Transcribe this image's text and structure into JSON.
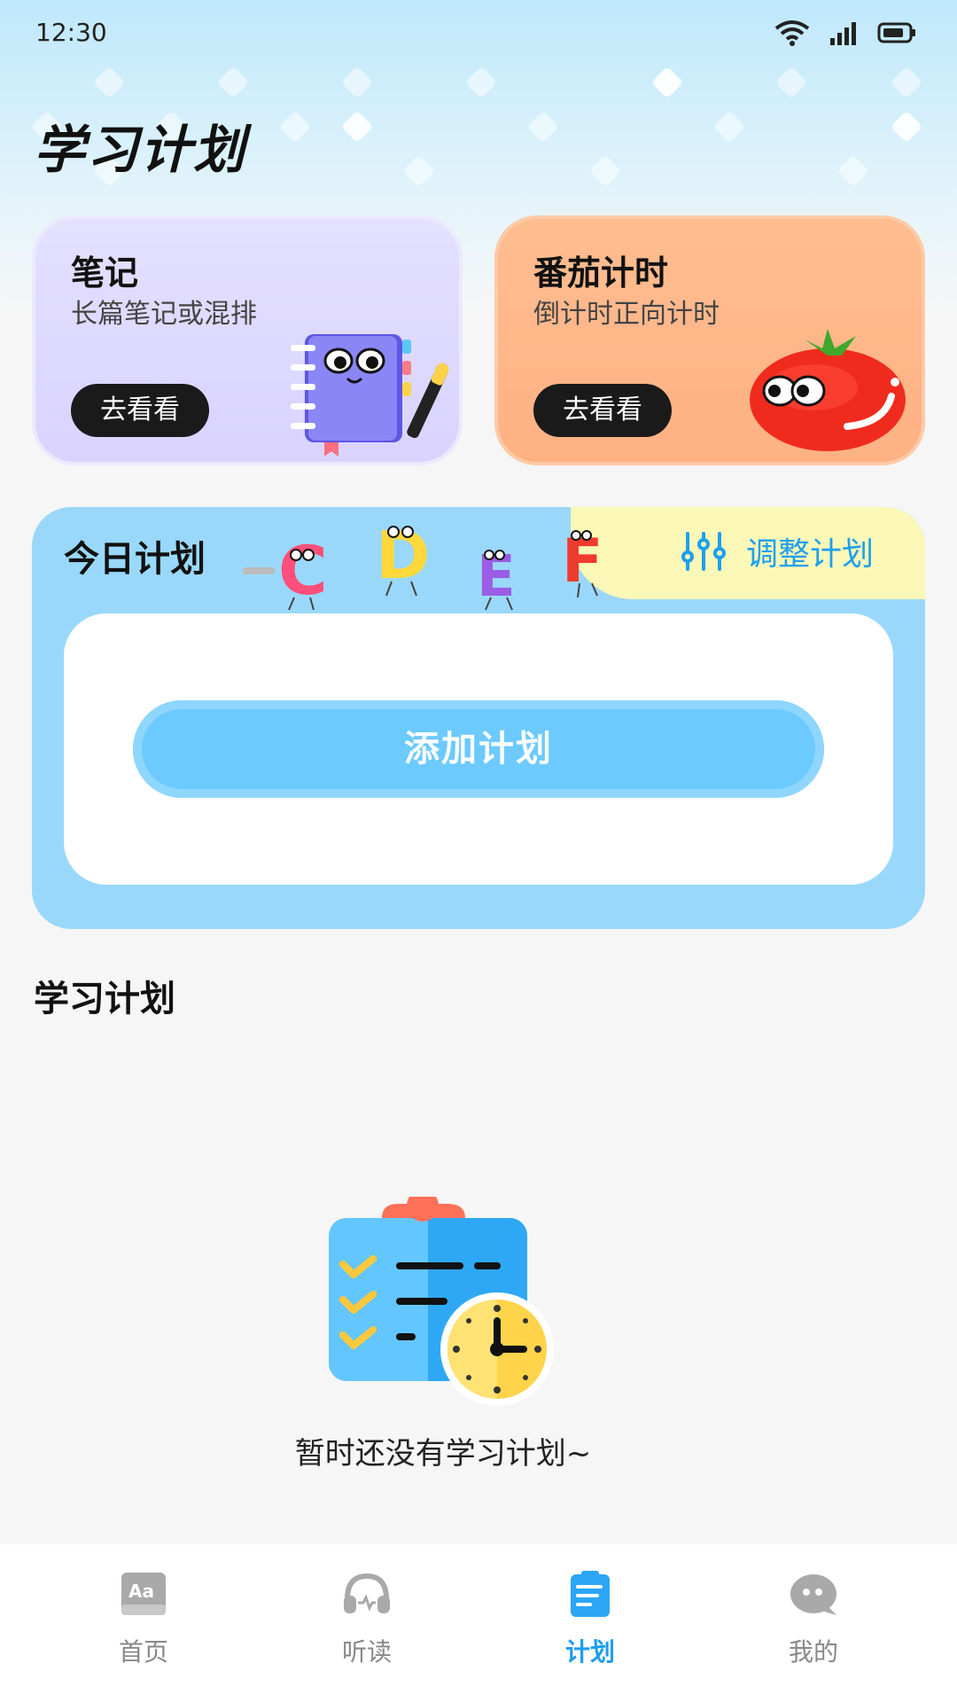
{
  "status_bar": {
    "time": "12:30"
  },
  "page_title": "学习计划",
  "cards": [
    {
      "title": "笔记",
      "subtitle": "长篇笔记或混排",
      "button": "去看看",
      "icon": "notebook-mascot-icon"
    },
    {
      "title": "番茄计时",
      "subtitle": "倒计时正向计时",
      "button": "去看看",
      "icon": "tomato-mascot-icon"
    }
  ],
  "today_plan": {
    "title": "今日计划",
    "adjust_label": "调整计划",
    "add_button": "添加计划",
    "letters": [
      "C",
      "D",
      "E",
      "F"
    ]
  },
  "plans_section": {
    "title": "学习计划",
    "empty_text": "暂时还没有学习计划~"
  },
  "nav": {
    "items": [
      {
        "label": "首页",
        "icon": "home-book-icon",
        "active": false
      },
      {
        "label": "听读",
        "icon": "headphones-icon",
        "active": false
      },
      {
        "label": "计划",
        "icon": "plan-clipboard-icon",
        "active": true
      },
      {
        "label": "我的",
        "icon": "profile-bubble-icon",
        "active": false
      }
    ]
  },
  "colors": {
    "accent": "#1e9cf0",
    "notes_card": "#dcd7ff",
    "tomato_card": "#ffb68a",
    "today_panel": "#9ad8fb"
  }
}
